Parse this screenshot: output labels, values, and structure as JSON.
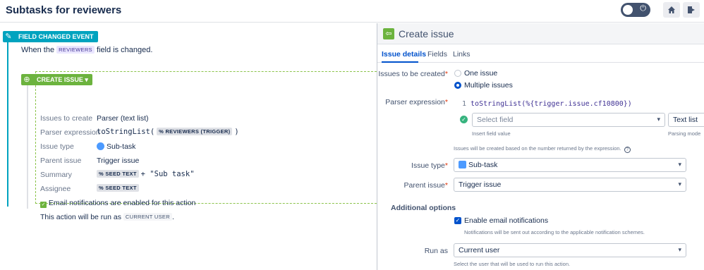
{
  "header": {
    "title": "Subtasks for reviewers"
  },
  "flow": {
    "event_label": "FIELD CHANGED EVENT",
    "when_prefix": "When the",
    "when_field": "REVIEWERS",
    "when_suffix": "field is changed.",
    "action_label": "CREATE ISSUE",
    "rows": {
      "issues_to_create_label": "Issues to create",
      "issues_to_create_value": "Parser (text list)",
      "parser_expression_label": "Parser expression",
      "parser_fn": "toStringList(",
      "parser_tag": "% REVIEWERS (TRIGGER)",
      "parser_close": ")",
      "issue_type_label": "Issue type",
      "issue_type_value": "Sub-task",
      "parent_issue_label": "Parent issue",
      "parent_issue_value": "Trigger issue",
      "summary_label": "Summary",
      "summary_tag": "% SEED TEXT",
      "summary_rest": "+ \"Sub task\"",
      "assignee_label": "Assignee",
      "assignee_tag": "% SEED TEXT",
      "email_note": "Email notifications are enabled for this action",
      "run_as_prefix": "This action will be run as",
      "run_as_tag": "CURRENT USER",
      "run_as_suffix": "."
    }
  },
  "panel": {
    "title": "Create issue",
    "tabs": [
      "Issue details",
      "Fields",
      "Links"
    ],
    "issues_to_be_created_label": "Issues to be created",
    "option_one": "One issue",
    "option_multiple": "Multiple issues",
    "parser_expression_label": "Parser expression",
    "code_line_number": "1",
    "code_text": "toStringList(%{trigger.issue.cf10800})",
    "select_field_placeholder": "Select field",
    "insert_field_hint": "Insert field value",
    "parsing_mode_value": "Text list",
    "parsing_mode_hint": "Parsing mode",
    "expression_note": "Issues will be created based on the number returned by the expression.",
    "issue_type_label": "Issue type",
    "issue_type_value": "Sub-task",
    "parent_issue_label": "Parent issue",
    "parent_issue_value": "Trigger issue",
    "additional_options_label": "Additional options",
    "enable_email_label": "Enable email notifications",
    "email_hint": "Notifications will be sent out according to the applicable notification schemes.",
    "run_as_label": "Run as",
    "run_as_value": "Current user",
    "run_as_hint": "Select the user that will be used to run this action."
  },
  "icons": {
    "edit": "pencil-icon",
    "home": "home-icon",
    "exit": "exit-icon",
    "power": "power-icon",
    "back": "back-arrow-icon"
  }
}
